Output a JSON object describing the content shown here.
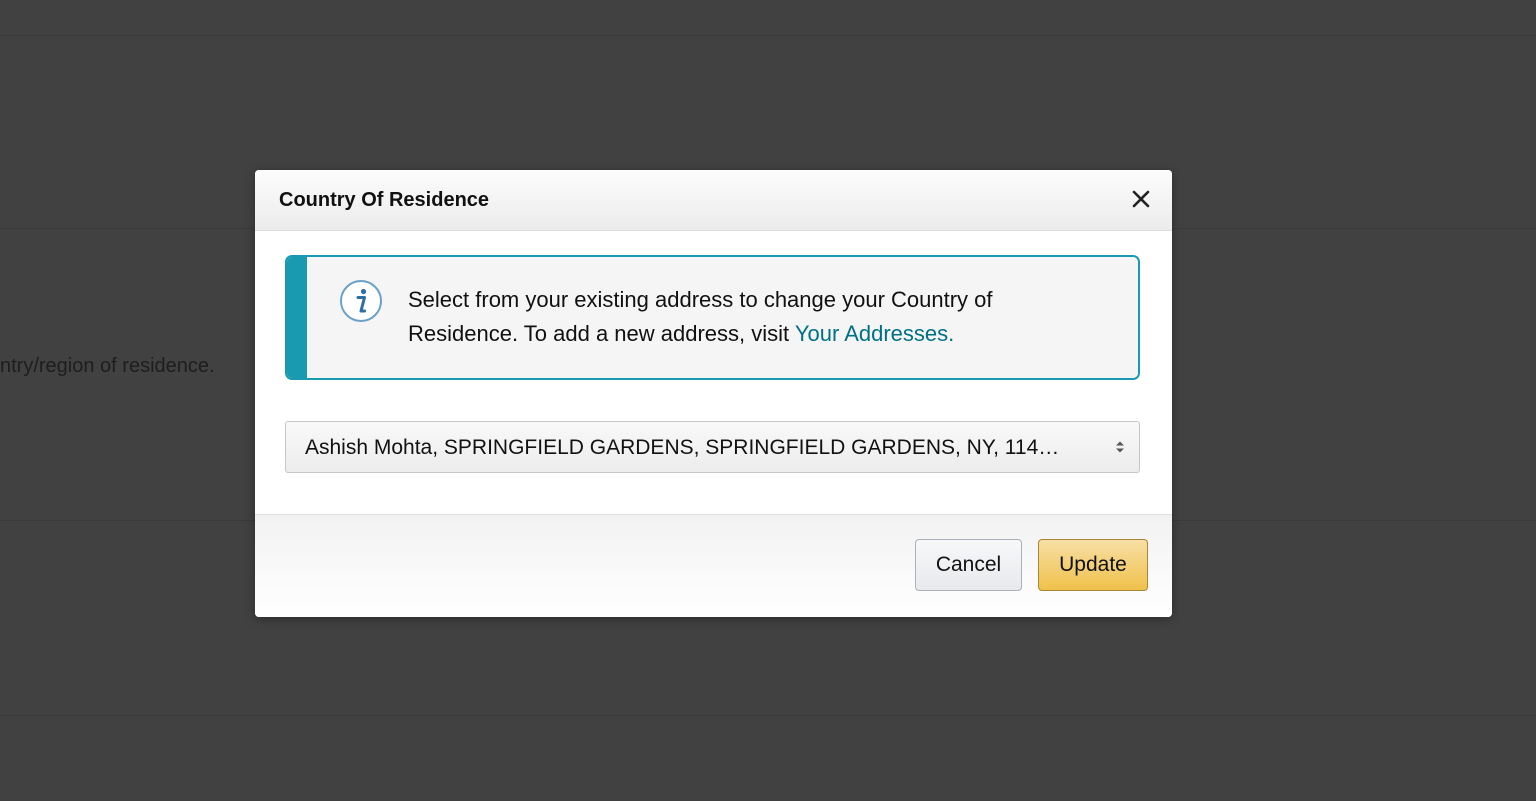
{
  "background": {
    "partial_text": "ntry/region of residence."
  },
  "dialog": {
    "title": "Country Of Residence",
    "close_icon": "close-icon",
    "info": {
      "icon": "info-icon",
      "text": "Select from your existing address to change your Country of Residence. To add a new address, visit ",
      "link_text": "Your Addresses."
    },
    "address_select": {
      "selected_value": "Ashish Mohta, SPRINGFIELD GARDENS, SPRINGFIELD GARDENS, NY, 114…"
    },
    "buttons": {
      "cancel_label": "Cancel",
      "update_label": "Update"
    }
  },
  "colors": {
    "accent": "#1a9ab0",
    "link": "#007185",
    "update_button": "#f0c14b",
    "backdrop": "#414141"
  }
}
